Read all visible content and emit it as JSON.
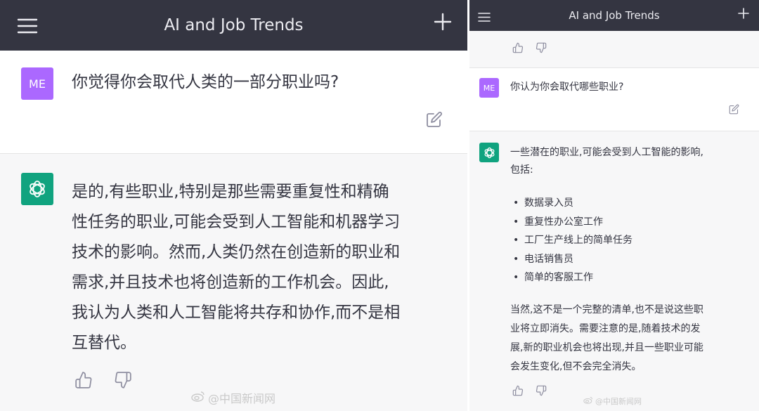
{
  "left": {
    "title": "AI and Job Trends",
    "user": {
      "avatar": "ME",
      "text": "你觉得你会取代人类的一部分职业吗?"
    },
    "assistant": {
      "lines": [
        "是的,有些职业,特别是那些需要重复性和精确",
        "性任务的职业,可能会受到人工智能和机器学习",
        "技术的影响。然而,人类仍然在创造新的职业和",
        "需求,并且技术也将创造新的工作机会。因此,",
        "我认为人类和人工智能将共存和协作,而不是相",
        "互替代。"
      ]
    },
    "watermark": "@中国新闻网"
  },
  "right": {
    "title": "AI and Job Trends",
    "user": {
      "avatar": "ME",
      "text": "你认为你会取代哪些职业?"
    },
    "assistant": {
      "intro_lines": [
        "一些潜在的职业,可能会受到人工智能的影响,",
        "包括:"
      ],
      "items": [
        "数据录入员",
        "重复性办公室工作",
        "工厂生产线上的简单任务",
        "电话销售员",
        "简单的客服工作"
      ],
      "outro_lines": [
        "当然,这不是一个完整的清单,也不是说这些职",
        "业将立即消失。需要注意的是,随着技术的发",
        "展,新的职业机会也将出现,并且一些职业可能",
        "会发生变化,但不会完全消失。"
      ]
    },
    "watermark": "@中国新闻网"
  },
  "colors": {
    "header_bg": "#343541",
    "user_avatar": "#ab68ff",
    "bot_avatar": "#10a37f",
    "assistant_bg": "#f7f7f8",
    "icon_gray": "#8e8ea0"
  },
  "icons": [
    "menu-icon",
    "plus-icon",
    "edit-icon",
    "chatgpt-logo-icon",
    "thumbs-up-icon",
    "thumbs-down-icon",
    "weibo-icon"
  ]
}
